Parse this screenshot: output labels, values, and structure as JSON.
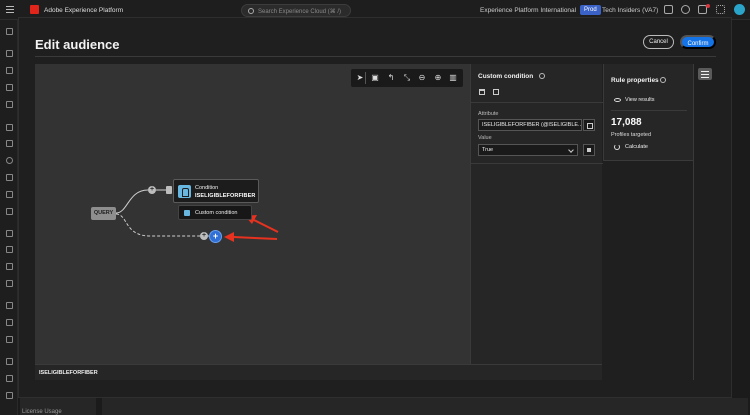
{
  "topbar": {
    "app_title": "Adobe Experience Platform",
    "search_placeholder": "Search Experience Cloud (⌘ /)",
    "org_name": "Experience Platform International",
    "env_badge": "Prod",
    "sandbox_name": "Tech Insiders (VA7)"
  },
  "modal": {
    "title": "Edit audience",
    "cancel_label": "Cancel",
    "confirm_label": "Confirm"
  },
  "canvas": {
    "query_label": "QUERY",
    "condition_type": "Condition",
    "condition_name": "ISELIGIBLEFORFIBER",
    "popup_label": "Custom condition",
    "footer_label": "ISELIGIBLEFORFIBER",
    "toolbar_icons": [
      "pointer-icon",
      "lock-icon",
      "undo-icon",
      "collapse-icon",
      "zoom-out-icon",
      "zoom-in-icon",
      "fit-icon"
    ]
  },
  "condition_panel": {
    "title": "Custom condition",
    "attribute_label": "Attribute",
    "attribute_value": "ISELIGIBLEFORFIBER (@ISELIGIBLE...",
    "value_label": "Value",
    "value_selected": "True"
  },
  "rule_panel": {
    "title": "Rule properties",
    "view_results": "View results",
    "count": "17,088",
    "count_label": "Profiles targeted",
    "calculate": "Calculate"
  },
  "footer": {
    "license_label": "License Usage"
  },
  "colors": {
    "accent_blue": "#1473e6",
    "arrow_red": "#e8321f",
    "condition_icon": "#67b7e0"
  }
}
